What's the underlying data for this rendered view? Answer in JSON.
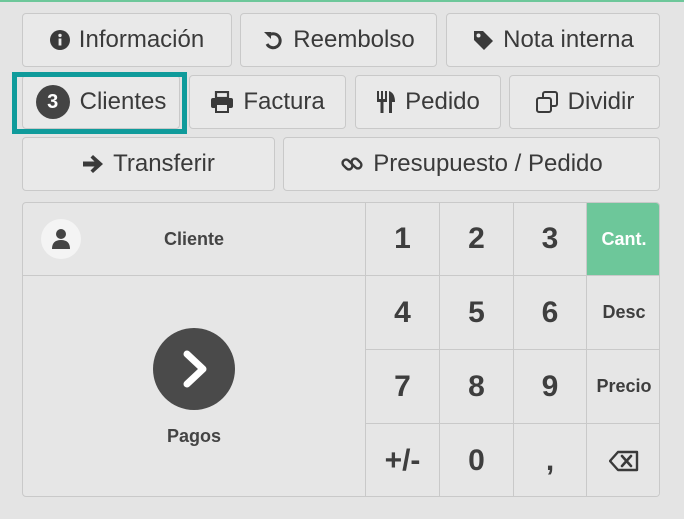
{
  "actions": {
    "informacion": "Información",
    "reembolso": "Reembolso",
    "nota_interna": "Nota interna",
    "clientes": "Clientes",
    "clientes_count": "3",
    "factura": "Factura",
    "pedido": "Pedido",
    "dividir": "Dividir",
    "transferir": "Transferir",
    "presupuesto": "Presupuesto / Pedido"
  },
  "numpad": {
    "customer_label": "Cliente",
    "payment_label": "Pagos",
    "keys": [
      "1",
      "2",
      "3",
      "4",
      "5",
      "6",
      "7",
      "8",
      "9",
      "+/-",
      "0",
      ","
    ],
    "modes": [
      "Cant.",
      "Desc",
      "Precio"
    ],
    "active_mode": "Cant."
  },
  "icons": {
    "info": "info-circle-icon",
    "refund": "undo-icon",
    "note": "tag-icon",
    "invoice": "printer-icon",
    "order": "utensils-icon",
    "split": "clone-icon",
    "transfer": "arrow-right-icon",
    "quote": "link-icon",
    "customer": "user-icon",
    "payment": "chevron-right-icon",
    "backspace": "backspace-icon"
  },
  "colors": {
    "accent": "#6dc79a",
    "highlight_border": "#0f9b9b",
    "badge": "#444444"
  }
}
